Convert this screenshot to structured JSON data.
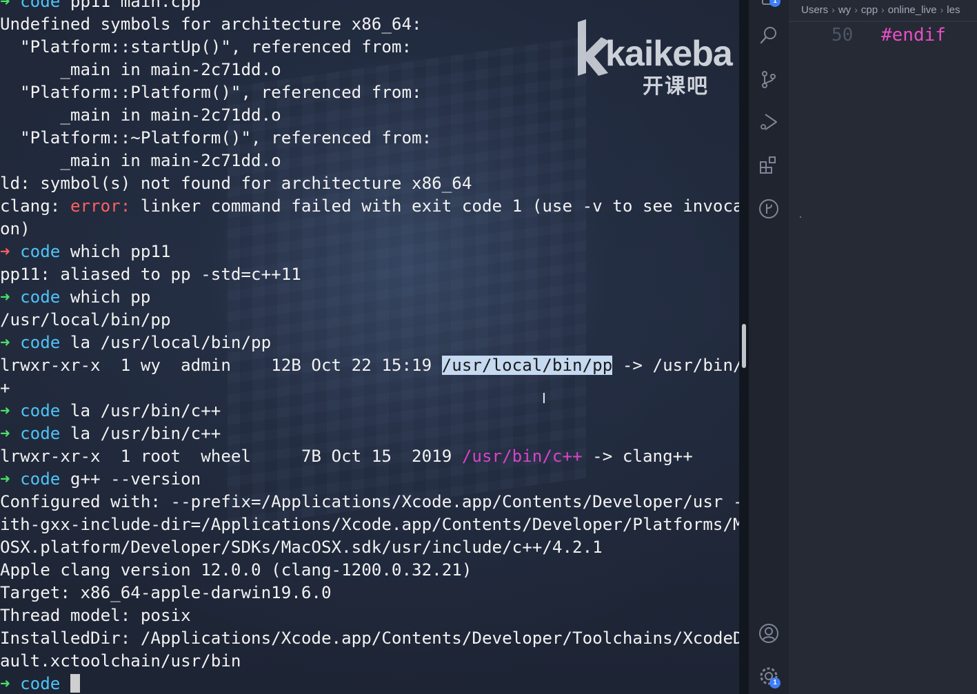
{
  "terminal": {
    "partial_top": "code pp11 main.cpp",
    "lines": {
      "l1": "Undefined symbols for architecture x86_64:",
      "l2": "  \"Platform::startUp()\", referenced from:",
      "l3": "      _main in main-2c71dd.o",
      "l4": "  \"Platform::Platform()\", referenced from:",
      "l5": "      _main in main-2c71dd.o",
      "l6": "  \"Platform::~Platform()\", referenced from:",
      "l7": "      _main in main-2c71dd.o",
      "l8": "ld: symbol(s) not found for architecture x86_64",
      "l9_prefix": "clang: ",
      "l9_error": "error:",
      "l9_rest": " linker command failed with exit code 1 (use -v to see invocati",
      "l10": "on)",
      "l12": "pp11: aliased to pp -std=c++11",
      "l14": "/usr/local/bin/pp",
      "l16_a": "lrwxr-xr-x  1 wy  admin    12B Oct 22 15:19 ",
      "l16_sel": "/usr/local/bin/pp",
      "l16_b": " -> /usr/bin/c+",
      "l17": "+",
      "l20_a": "lrwxr-xr-x  1 root  wheel     7B Oct 15  2019 ",
      "l20_link": "/usr/bin/c++",
      "l20_b": " -> clang++",
      "l22": "Configured with: --prefix=/Applications/Xcode.app/Contents/Developer/usr --w",
      "l23": "ith-gxx-include-dir=/Applications/Xcode.app/Contents/Developer/Platforms/Mac",
      "l24": "OSX.platform/Developer/SDKs/MacOSX.sdk/usr/include/c++/4.2.1",
      "l25": "Apple clang version 12.0.0 (clang-1200.0.32.21)",
      "l26": "Target: x86_64-apple-darwin19.6.0",
      "l27": "Thread model: posix",
      "l28": "InstalledDir: /Applications/Xcode.app/Contents/Developer/Toolchains/XcodeDef",
      "l29": "ault.xctoolchain/usr/bin"
    },
    "prompt_arrow": "➜",
    "prompt_dir": "code",
    "commands": {
      "c11": " which pp11",
      "c13": " which pp",
      "c15": " la /usr/local/bin/pp",
      "c18": " la /usr/bin/c++",
      "c19": " la /usr/bin/c++",
      "c21": " g++ --version",
      "c30": " "
    }
  },
  "watermark": {
    "logo_text": "kaikeba",
    "logo_cn": "开课吧"
  },
  "editor": {
    "breadcrumb": [
      "Users",
      "wy",
      "cpp",
      "online_live",
      "les"
    ],
    "line_number": "50",
    "code": "#endif"
  },
  "activity_bar": {
    "badges": {
      "top": "1",
      "settings": "1"
    },
    "icons": [
      "files-icon",
      "search-icon",
      "source-control-icon",
      "run-debug-icon",
      "extensions-icon",
      "git-graph-icon",
      "account-icon",
      "settings-gear-icon"
    ]
  },
  "colors": {
    "prompt_ok": "#4de06a",
    "prompt_fail": "#ff5f5f",
    "dir": "#4fc3f7",
    "symlink": "#d844c8",
    "selection": "#c5d9f0",
    "macro": "#e84fc6"
  }
}
